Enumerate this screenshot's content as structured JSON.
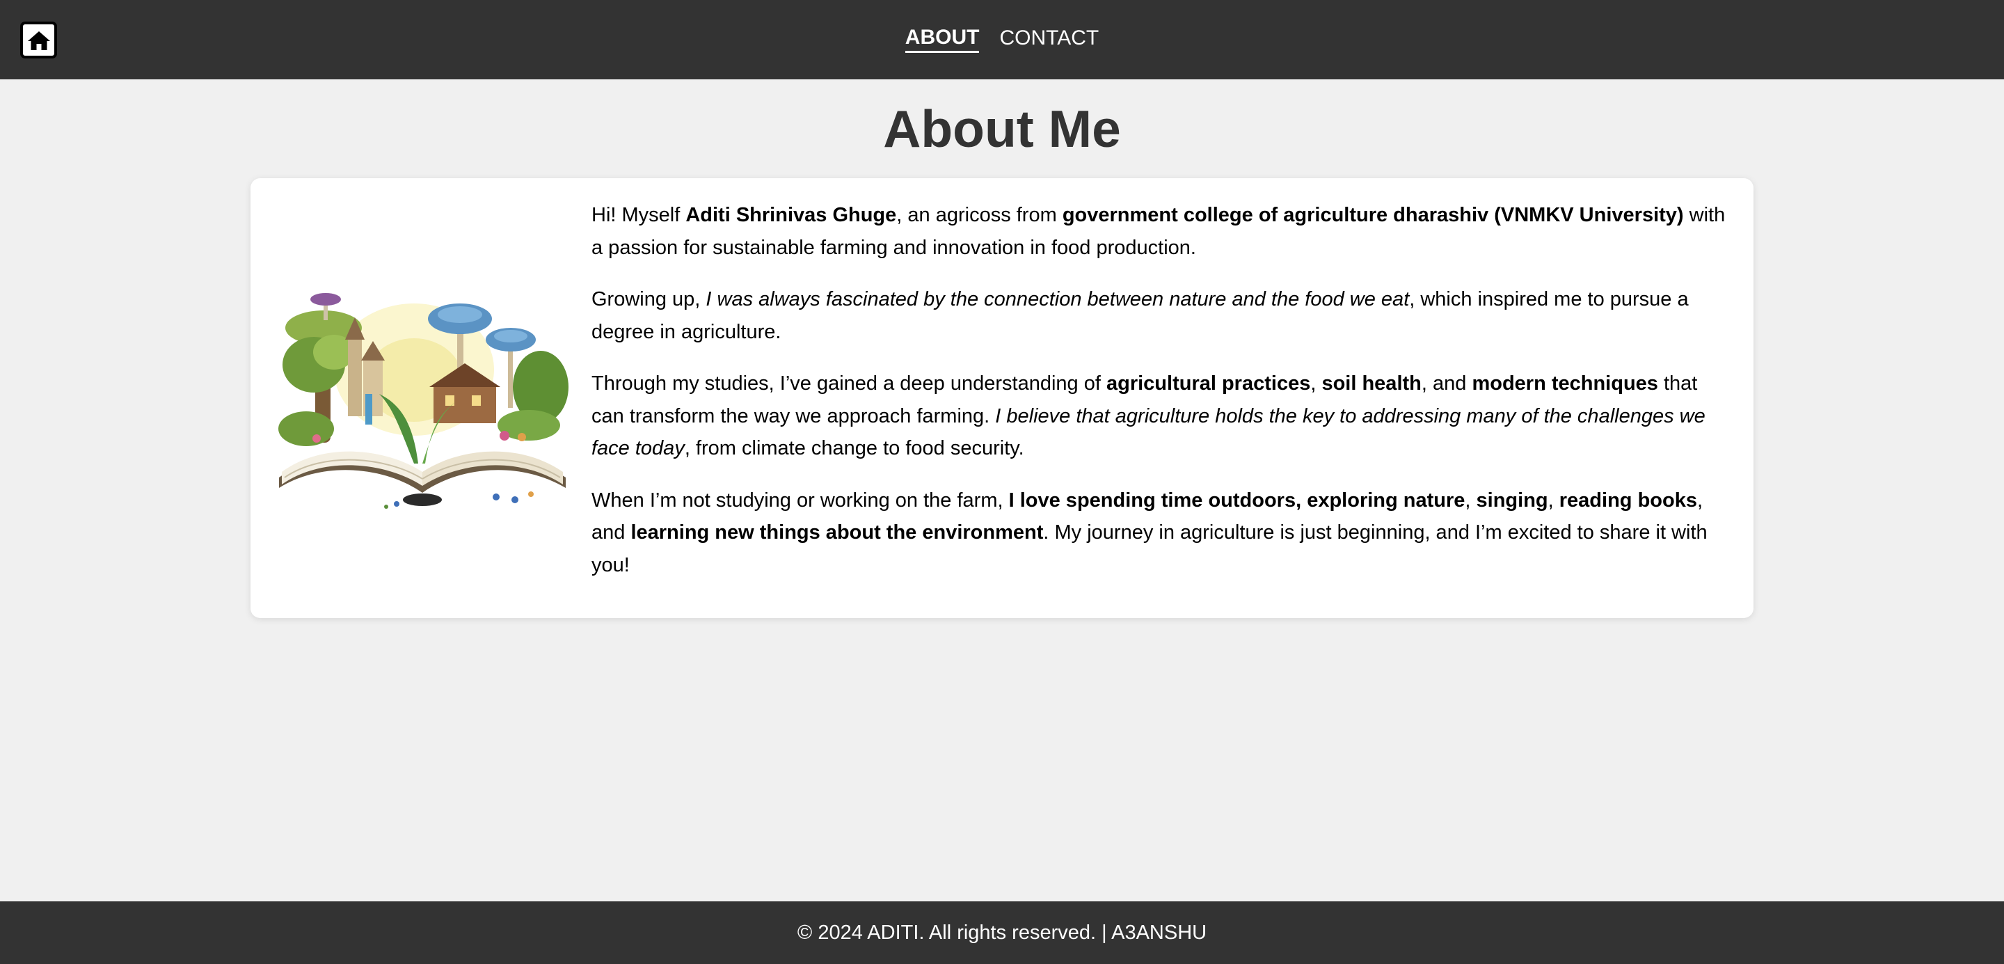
{
  "header": {
    "home_icon": "home-icon",
    "nav": {
      "about": "ABOUT",
      "contact": "CONTACT"
    }
  },
  "page_title": "About Me",
  "about": {
    "p1": {
      "t1": "Hi! Myself ",
      "b1": "Aditi Shrinivas Ghuge",
      "t2": ", an agricoss from ",
      "b2": "government college of agriculture dharashiv (VNMKV University)",
      "t3": " with a passion for sustainable farming and innovation in food production."
    },
    "p2": {
      "t1": "Growing up, ",
      "i1": "I was always fascinated by the connection between nature and the food we eat",
      "t2": ", which inspired me to pursue a degree in agriculture."
    },
    "p3": {
      "t1": "Through my studies, I’ve gained a deep understanding of ",
      "b1": "agricultural practices",
      "t2": ", ",
      "b2": "soil health",
      "t3": ", and ",
      "b3": "modern techniques",
      "t4": " that can transform the way we approach farming. ",
      "i1": "I believe that agriculture holds the key to addressing many of the challenges we face today",
      "t5": ", from climate change to food security."
    },
    "p4": {
      "t1": "When I’m not studying or working on the farm, ",
      "b1": "I love spending time outdoors, exploring nature",
      "t2": ", ",
      "b2": "singing",
      "t3": ", ",
      "b3": "reading books",
      "t4": ", and ",
      "b4": "learning new things about the environment",
      "t5": ". My journey in agriculture is just beginning, and I’m excited to share it with you!"
    }
  },
  "footer": {
    "text": "© 2024 ADITI. All rights reserved. | A3ANSHU"
  },
  "colors": {
    "bar": "#333333",
    "page_bg": "#f0f0f0",
    "title": "#333333"
  }
}
